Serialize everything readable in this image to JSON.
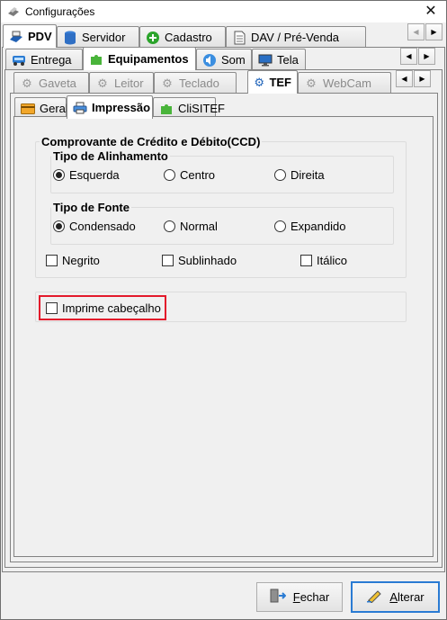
{
  "window": {
    "title": "Configurações",
    "close_glyph": "✕"
  },
  "tabs_main": [
    {
      "label": "PDV",
      "icon": "pdv-icon"
    },
    {
      "label": "Servidor",
      "icon": "server-icon"
    },
    {
      "label": "Cadastro",
      "icon": "plus-circle-icon"
    },
    {
      "label": "DAV / Pré-Venda",
      "icon": "document-icon"
    }
  ],
  "tabs_pdv": [
    {
      "label": "Entrega",
      "icon": "truck-icon"
    },
    {
      "label": "Equipamentos",
      "icon": "puzzle-icon"
    },
    {
      "label": "Som",
      "icon": "speaker-icon"
    },
    {
      "label": "Tela",
      "icon": "monitor-icon"
    }
  ],
  "tabs_equip": [
    {
      "label": "Gaveta",
      "icon": "gear-icon"
    },
    {
      "label": "Leitor",
      "icon": "gear-icon"
    },
    {
      "label": "Teclado",
      "icon": "gear-icon"
    },
    {
      "label": "TEF",
      "icon": "gear-icon"
    },
    {
      "label": "WebCam",
      "icon": "gear-icon"
    }
  ],
  "tabs_tef": [
    {
      "label": "Geral",
      "icon": "card-icon"
    },
    {
      "label": "Impressão",
      "icon": "printer-icon"
    },
    {
      "label": "CliSITEF",
      "icon": "puzzle-icon"
    }
  ],
  "ccd": {
    "title": "Comprovante de Crédito e Débito(CCD)",
    "alignment": {
      "title": "Tipo de Alinhamento",
      "options": [
        "Esquerda",
        "Centro",
        "Direita"
      ],
      "selected": "Esquerda"
    },
    "font": {
      "title": "Tipo de Fonte",
      "options": [
        "Condensado",
        "Normal",
        "Expandido"
      ],
      "selected": "Condensado"
    },
    "styles": [
      "Negrito",
      "Sublinhado",
      "Itálico"
    ]
  },
  "header_option": {
    "label": "Imprime cabeçalho",
    "checked": false
  },
  "buttons": {
    "close_label": "Fechar",
    "close_accel": "F",
    "close_rest": "echar",
    "alter_label": "Alterar",
    "alter_accel": "A",
    "alter_rest": "lterar"
  },
  "colors": {
    "highlight": "#e3192b",
    "focus_border": "#2a7bd3"
  }
}
